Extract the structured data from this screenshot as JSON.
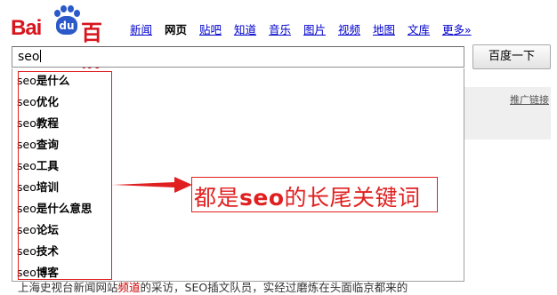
{
  "logo": {
    "latin": "Bai",
    "paw": "du",
    "chinese": "百度"
  },
  "nav": [
    {
      "label": "新闻",
      "current": false
    },
    {
      "label": "网页",
      "current": true
    },
    {
      "label": "贴吧",
      "current": false
    },
    {
      "label": "知道",
      "current": false
    },
    {
      "label": "音乐",
      "current": false
    },
    {
      "label": "图片",
      "current": false
    },
    {
      "label": "视频",
      "current": false
    },
    {
      "label": "地图",
      "current": false
    },
    {
      "label": "文库",
      "current": false
    },
    {
      "label": "更多»",
      "current": false
    }
  ],
  "search": {
    "value": "seo",
    "button_label": "百度一下"
  },
  "sidebar": {
    "ad_link": "推广链接"
  },
  "suggestions": [
    {
      "query": "seo",
      "rest": "是什么"
    },
    {
      "query": "seo",
      "rest": "优化"
    },
    {
      "query": "seo",
      "rest": "教程"
    },
    {
      "query": "seo",
      "rest": "查询"
    },
    {
      "query": "seo",
      "rest": "工具"
    },
    {
      "query": "seo",
      "rest": "培训"
    },
    {
      "query": "seo",
      "rest": "是什么意思"
    },
    {
      "query": "seo",
      "rest": "论坛"
    },
    {
      "query": "seo",
      "rest": "技术"
    },
    {
      "query": "seo",
      "rest": "博客"
    }
  ],
  "annotation": {
    "pre": "都是",
    "latin": "seo",
    "post": "的长尾关键词"
  },
  "background_text": {
    "pre": "上海史视台新闻网站",
    "highlight": "频道",
    "post": "的采访，SEO插文队员，实经过磨炼在头面临京都来的"
  },
  "colors": {
    "brand_red": "#d8141c",
    "brand_blue": "#2c59c9",
    "link": "#0000cc",
    "annotation_red": "#e02020"
  }
}
